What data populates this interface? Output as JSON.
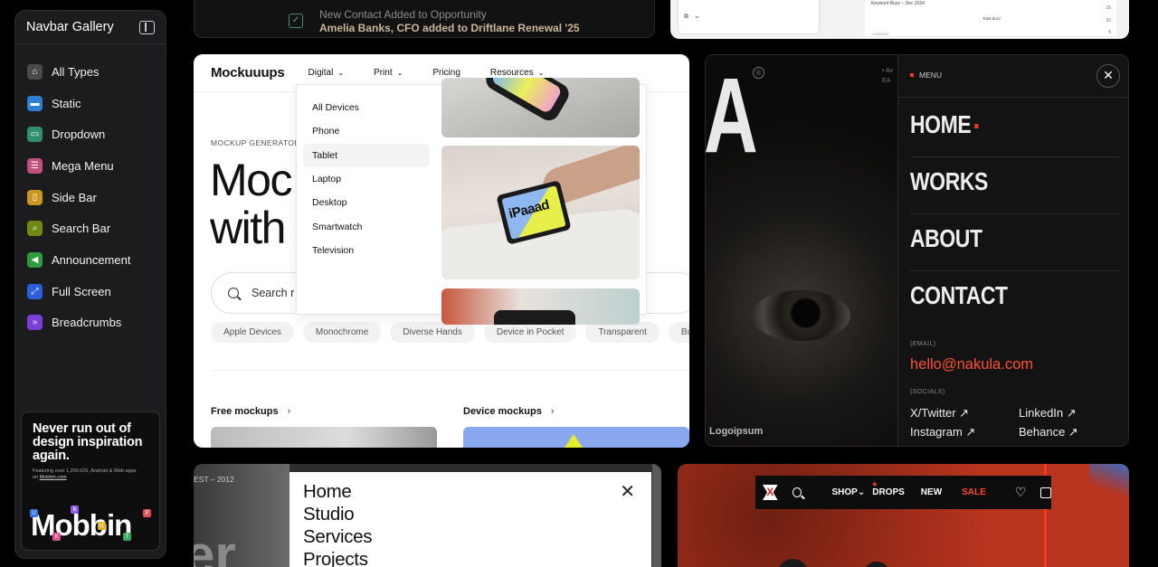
{
  "sidebar": {
    "title": "Navbar Gallery",
    "items": [
      {
        "label": "All Types",
        "icon": "home-icon",
        "color": "#4a4a4a"
      },
      {
        "label": "Static",
        "icon": "static-icon",
        "color": "#2f7fd1"
      },
      {
        "label": "Dropdown",
        "icon": "dropdown-icon",
        "color": "#2e8f6a"
      },
      {
        "label": "Mega Menu",
        "icon": "mega-menu-icon",
        "color": "#c2507d"
      },
      {
        "label": "Side Bar",
        "icon": "side-bar-icon",
        "color": "#c9961f"
      },
      {
        "label": "Search Bar",
        "icon": "search-bar-icon",
        "color": "#6f8a12"
      },
      {
        "label": "Announcement",
        "icon": "announcement-icon",
        "color": "#2f9a3e"
      },
      {
        "label": "Full Screen",
        "icon": "full-screen-icon",
        "color": "#2b5fd9"
      },
      {
        "label": "Breadcrumbs",
        "icon": "breadcrumbs-icon",
        "color": "#7a3fd6"
      }
    ],
    "promo": {
      "title": "Never run out of design inspiration again.",
      "subtitle": "Featuring over 1,200 iOS, Android & Web apps on",
      "link": "Mobbin.com",
      "brand": "Mobbin"
    }
  },
  "top_card_1": {
    "line1": "New Contact Added to Opportunity",
    "line2": "Amelia Banks, CFO added to Driftlane Renewal '25"
  },
  "top_card_2": {
    "chart_title": "Keyword Buzz – Dec 2024",
    "legend": "Total buzz",
    "axis": [
      "15",
      "10",
      "5"
    ],
    "foot": "1,000.000"
  },
  "mockuuups": {
    "logo": "Mockuuups",
    "nav": [
      {
        "label": "Digital",
        "chevron": true
      },
      {
        "label": "Print",
        "chevron": true
      },
      {
        "label": "Pricing",
        "chevron": false
      },
      {
        "label": "Resources",
        "chevron": true
      }
    ],
    "kicker": "MOCKUP GENERATOR",
    "hero_line1": "Moc",
    "hero_line2": "with",
    "search_placeholder": "Search r",
    "chips": [
      "Apple Devices",
      "Monochrome",
      "Diverse Hands",
      "Device in Pocket",
      "Transparent",
      "Busi"
    ],
    "sections": [
      "Free mockups",
      "Device mockups"
    ],
    "dropdown": {
      "items": [
        "All Devices",
        "Phone",
        "Tablet",
        "Laptop",
        "Desktop",
        "Smartwatch",
        "Television"
      ],
      "highlighted_index": 2,
      "tablet_brand": "iPaaad"
    }
  },
  "dark_menu": {
    "big_letter": "A",
    "reg_mark": "®",
    "corner_text": "• Av",
    "corner_text2": "EA",
    "menu_label": "MENU",
    "close": "✕",
    "items": [
      "HOME",
      "WORKS",
      "ABOUT",
      "CONTACT"
    ],
    "email_caption": "(EMAIL)",
    "email": "hello@nakula.com",
    "socials_caption": "(SOCIALS)",
    "socials": [
      "X/Twitter ↗",
      "LinkedIn ↗",
      "Instagram ↗",
      "Behance ↗"
    ],
    "footer_logo": "Logoipsum",
    "accent": "#ff3b2f"
  },
  "bottom_card_1": {
    "est": "EST – 2012",
    "bg_text": "er",
    "menu": [
      "Home",
      "Studio",
      "Services",
      "Projects"
    ],
    "close": "✕"
  },
  "bottom_card_2": {
    "nav": [
      {
        "label": "SHOP",
        "chevron": "⌄"
      },
      {
        "label": "DROPS",
        "badge": "★"
      },
      {
        "label": "NEW"
      },
      {
        "label": "SALE"
      }
    ],
    "logo": "X"
  }
}
